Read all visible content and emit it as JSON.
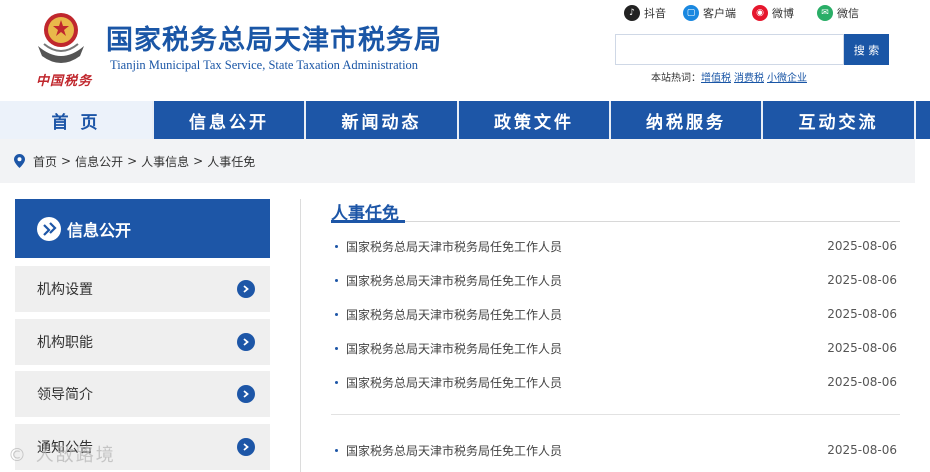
{
  "header": {
    "logo_script": "中国税务",
    "title": "国家税务总局天津市税务局",
    "subtitle": "Tianjin Municipal Tax Service, State Taxation Administration",
    "social": [
      {
        "label": "抖音",
        "icon": "douyin-icon"
      },
      {
        "label": "客户端",
        "icon": "app-client-icon"
      },
      {
        "label": "微博",
        "icon": "weibo-icon"
      },
      {
        "label": "微信",
        "icon": "wechat-icon"
      }
    ],
    "search": {
      "placeholder": "",
      "button": "搜 索"
    },
    "hotwords": {
      "label": "本站热词：",
      "items": [
        "增值税",
        "消费税",
        "小微企业"
      ]
    }
  },
  "nav": {
    "items": [
      "首 页",
      "信息公开",
      "新闻动态",
      "政策文件",
      "纳税服务",
      "互动交流"
    ],
    "active_index": 0
  },
  "breadcrumb": [
    "首页",
    "信息公开",
    "人事信息",
    "人事任免"
  ],
  "sidebar": {
    "heading": "信息公开",
    "items": [
      "机构设置",
      "机构职能",
      "领导简介",
      "通知公告"
    ]
  },
  "content": {
    "section_title": "人事任免",
    "rows": [
      {
        "title": "国家税务总局天津市税务局任免工作人员",
        "date": "2025-08-06"
      },
      {
        "title": "国家税务总局天津市税务局任免工作人员",
        "date": "2025-08-06"
      },
      {
        "title": "国家税务总局天津市税务局任免工作人员",
        "date": "2025-08-06"
      },
      {
        "title": "国家税务总局天津市税务局任免工作人员",
        "date": "2025-08-06"
      },
      {
        "title": "国家税务总局天津市税务局任免工作人员",
        "date": "2025-08-06"
      },
      {
        "title": "国家税务总局天津市税务局任免工作人员",
        "date": "2025-08-06"
      }
    ]
  },
  "watermark": "© 人敌路境",
  "colors": {
    "primary": "#1d56a7",
    "emblem_red": "#c0272d",
    "nav_active_bg": "#ecf2fa"
  }
}
